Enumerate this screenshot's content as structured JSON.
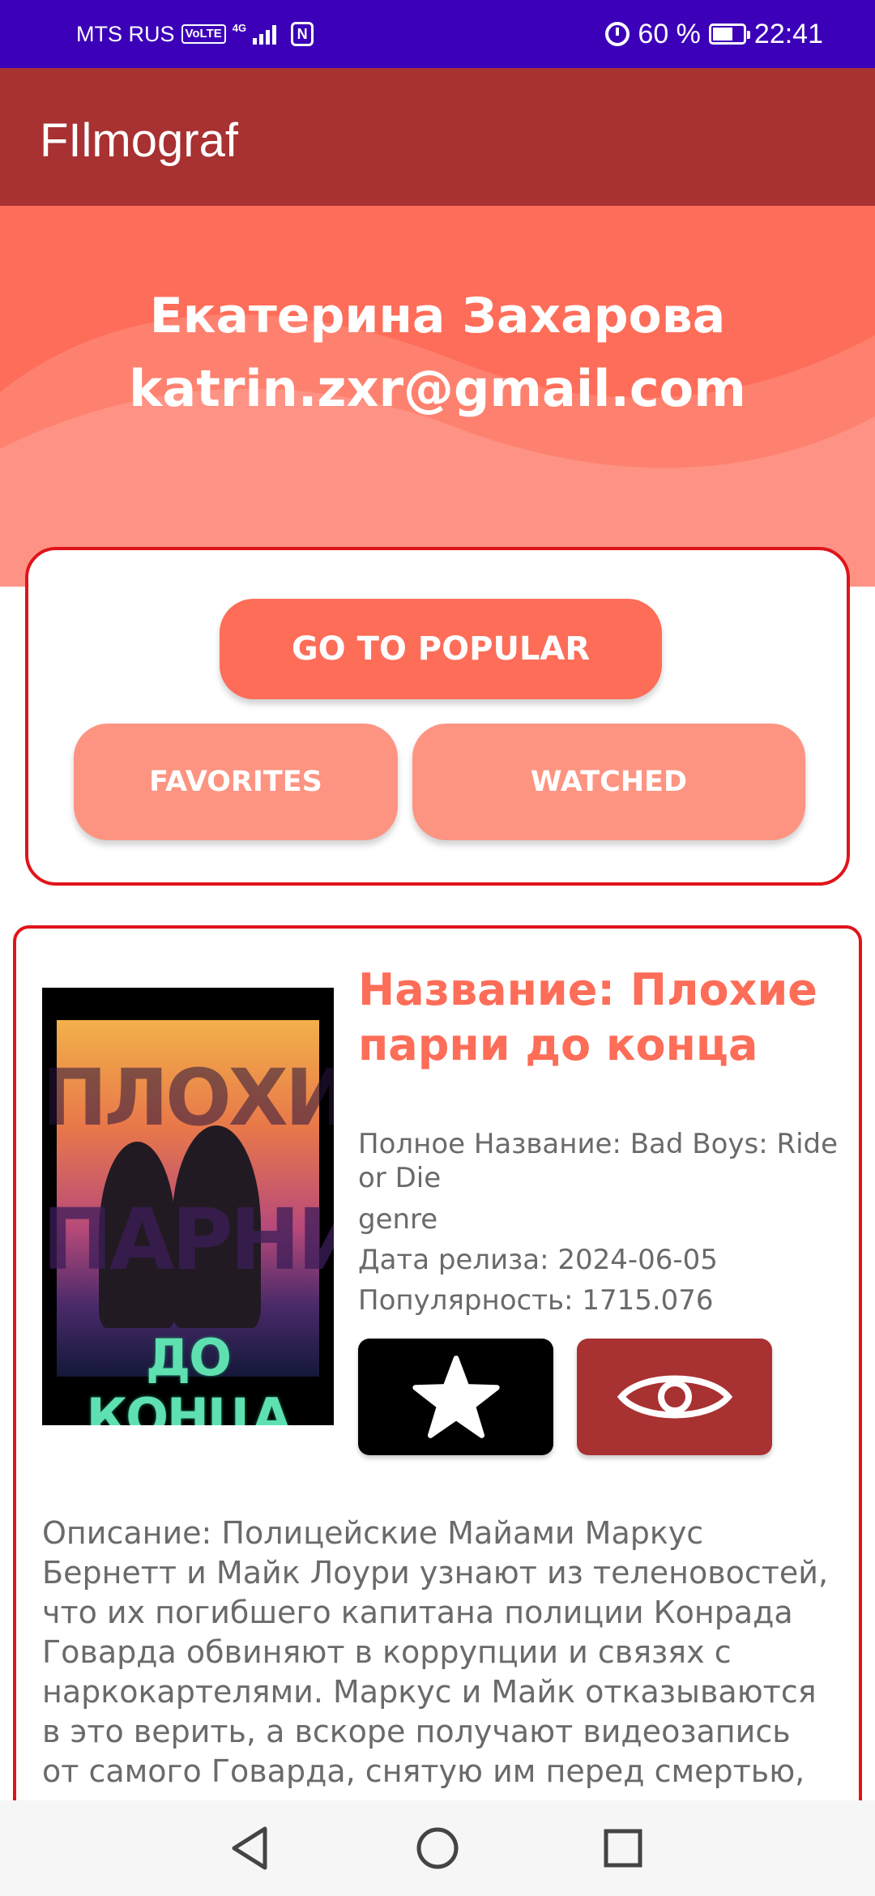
{
  "status_bar": {
    "carrier": "MTS RUS",
    "volte": "VoLTE",
    "network": "4G",
    "nfc": "N",
    "battery": "60 %",
    "time": "22:41"
  },
  "app_bar": {
    "title": "FIlmograf"
  },
  "profile": {
    "name": "Екатерина Захарова",
    "email": "katrin.zxr@gmail.com"
  },
  "actions": {
    "popular_label": "GO TO POPULAR",
    "favorites_label": "FAVORITES",
    "watched_label": "WATCHED"
  },
  "movie": {
    "title": "Название: Плохие парни до конца",
    "full_title": "Полное Название: Bad Boys: Ride or Die",
    "genre": "genre",
    "release_date": "Дата релиза: 2024-06-05",
    "popularity": "Популярность: 1715.076",
    "poster_text": [
      "ПЛОХИЕ",
      "ПАРНИ",
      "ДО КОНЦА"
    ],
    "description": "Описание: Полицейские Майами Маркус Бернетт и Майк Лоури узнают из теленовостей, что их погибшего капитана полиции Конрада Говарда обвиняют в коррупции и связях с наркокартелями. Маркус и Майк отказываются в это верить, а вскоре получают видеозапись от самого Говарда, снятую им перед смертью,"
  },
  "colors": {
    "status_bar": "#3b00b8",
    "app_bar": "#a83132",
    "accent": "#fd6d58",
    "accent_light": "#fd9482",
    "card_border": "#e0141b"
  },
  "icons": [
    "alarm-icon",
    "battery-icon",
    "star-icon",
    "eye-icon",
    "back-icon",
    "home-icon",
    "recent-apps-icon"
  ]
}
